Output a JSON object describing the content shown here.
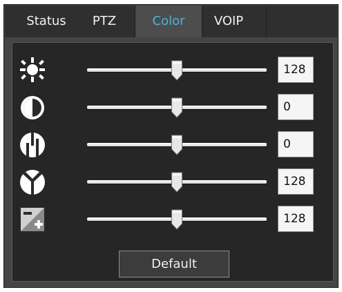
{
  "tabs": [
    {
      "label": "Status",
      "active": false
    },
    {
      "label": "PTZ",
      "active": false
    },
    {
      "label": "Color",
      "active": true
    },
    {
      "label": "VOIP",
      "active": false
    }
  ],
  "colors": {
    "active_tab_text": "#4fb2d6",
    "panel_bg": "#262626"
  },
  "controls": [
    {
      "icon": "brightness-icon",
      "level_percent": 50,
      "value": "128"
    },
    {
      "icon": "contrast-icon",
      "level_percent": 50,
      "value": "0"
    },
    {
      "icon": "saturation-icon",
      "level_percent": 50,
      "value": "0"
    },
    {
      "icon": "hue-icon",
      "level_percent": 50,
      "value": "128"
    },
    {
      "icon": "sharpness-icon",
      "level_percent": 50,
      "value": "128"
    }
  ],
  "default_button": {
    "label": "Default"
  }
}
